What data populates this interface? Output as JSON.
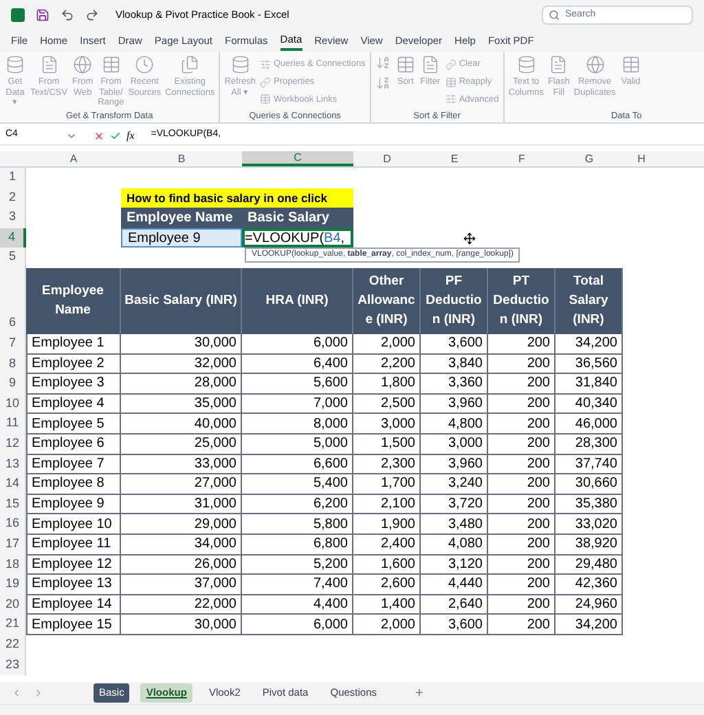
{
  "title_bar": {
    "title": "Vlookup & Pivot Practice Book  -  Excel",
    "search_placeholder": "Search"
  },
  "menu_tabs": [
    {
      "label": "File",
      "selected": false
    },
    {
      "label": "Home",
      "selected": false
    },
    {
      "label": "Insert",
      "selected": false
    },
    {
      "label": "Draw",
      "selected": false
    },
    {
      "label": "Page Layout",
      "selected": false
    },
    {
      "label": "Formulas",
      "selected": false
    },
    {
      "label": "Data",
      "selected": true
    },
    {
      "label": "Review",
      "selected": false
    },
    {
      "label": "View",
      "selected": false
    },
    {
      "label": "Developer",
      "selected": false
    },
    {
      "label": "Help",
      "selected": false
    },
    {
      "label": "Foxit PDF",
      "selected": false
    }
  ],
  "ribbon_groups": [
    {
      "label": "Get & Transform Data",
      "items": [
        {
          "kind": "large",
          "label": "Get Data ▾"
        },
        {
          "kind": "large",
          "label": "From Text/CSV"
        },
        {
          "kind": "large",
          "label": "From Web"
        },
        {
          "kind": "large",
          "label": "From Table/ Range"
        },
        {
          "kind": "large",
          "label": "Recent Sources"
        },
        {
          "kind": "large",
          "label": "Existing Connections"
        }
      ]
    },
    {
      "label": "Queries & Connections",
      "items": [
        {
          "kind": "large",
          "label": "Refresh All ▾"
        },
        {
          "kind": "small",
          "label": "Queries & Connections"
        },
        {
          "kind": "small",
          "label": "Properties"
        },
        {
          "kind": "small",
          "label": "Workbook Links"
        }
      ]
    },
    {
      "label": "Sort & Filter",
      "items": [
        {
          "kind": "sort",
          "label": "Sort"
        },
        {
          "kind": "large",
          "label": "Filter"
        },
        {
          "kind": "small",
          "label": "Clear"
        },
        {
          "kind": "small",
          "label": "Reapply"
        },
        {
          "kind": "small",
          "label": "Advanced"
        }
      ]
    },
    {
      "label": "Data To",
      "items": [
        {
          "kind": "large",
          "label": "Text to Columns"
        },
        {
          "kind": "large",
          "label": "Flash Fill"
        },
        {
          "kind": "large",
          "label": "Remove Duplicates"
        },
        {
          "kind": "large",
          "label": "Valid"
        }
      ]
    }
  ],
  "formula_bar": {
    "cell_ref": "C4",
    "function_label": "fx",
    "formula": "=VLOOKUP(B4,"
  },
  "columns": [
    {
      "label": "A",
      "selected": false
    },
    {
      "label": "B",
      "selected": false
    },
    {
      "label": "C",
      "selected": true
    },
    {
      "label": "D",
      "selected": false
    },
    {
      "label": "E",
      "selected": false
    },
    {
      "label": "F",
      "selected": false
    },
    {
      "label": "G",
      "selected": false
    },
    {
      "label": "H",
      "selected": false
    }
  ],
  "row_headers": [
    {
      "label": "1",
      "selected": false
    },
    {
      "label": "2",
      "selected": false
    },
    {
      "label": "3",
      "selected": false
    },
    {
      "label": "4",
      "selected": true
    },
    {
      "label": "5",
      "selected": false
    },
    {
      "label": "6",
      "selected": false
    },
    {
      "label": "7",
      "selected": false
    },
    {
      "label": "8",
      "selected": false
    },
    {
      "label": "9",
      "selected": false
    },
    {
      "label": "10",
      "selected": false
    },
    {
      "label": "11",
      "selected": false
    },
    {
      "label": "12",
      "selected": false
    },
    {
      "label": "13",
      "selected": false
    },
    {
      "label": "14",
      "selected": false
    },
    {
      "label": "15",
      "selected": false
    },
    {
      "label": "16",
      "selected": false
    },
    {
      "label": "17",
      "selected": false
    },
    {
      "label": "18",
      "selected": false
    },
    {
      "label": "19",
      "selected": false
    },
    {
      "label": "20",
      "selected": false
    },
    {
      "label": "21",
      "selected": false
    },
    {
      "label": "22",
      "selected": false
    },
    {
      "label": "23",
      "selected": false
    }
  ],
  "lookup": {
    "title": "How to find basic salary in one click",
    "headers": [
      "Employee Name",
      "Basic Salary"
    ],
    "employee": "Employee 9",
    "formula_start": "=VLOOKUP(",
    "formula_ref": "B4",
    "formula_end": ",",
    "tooltip": "VLOOKUP(lookup_value, **table_array**, col_index_num, [range_lookup])"
  },
  "table": {
    "columns": [
      "Employee Name",
      "Basic Salary (INR)",
      "HRA (INR)",
      "Other Allowance (INR)",
      "PF Deduction (INR)",
      "PT Deduction (INR)",
      "Total Salary (INR)"
    ],
    "rows": [
      [
        "Employee 1",
        "30,000",
        "6,000",
        "2,000",
        "3,600",
        "200",
        "34,200"
      ],
      [
        "Employee 2",
        "32,000",
        "6,400",
        "2,200",
        "3,840",
        "200",
        "36,560"
      ],
      [
        "Employee 3",
        "28,000",
        "5,600",
        "1,800",
        "3,360",
        "200",
        "31,840"
      ],
      [
        "Employee 4",
        "35,000",
        "7,000",
        "2,500",
        "3,960",
        "200",
        "40,340"
      ],
      [
        "Employee 5",
        "40,000",
        "8,000",
        "3,000",
        "4,800",
        "200",
        "46,000"
      ],
      [
        "Employee 6",
        "25,000",
        "5,000",
        "1,500",
        "3,000",
        "200",
        "28,300"
      ],
      [
        "Employee 7",
        "33,000",
        "6,600",
        "2,300",
        "3,960",
        "200",
        "37,740"
      ],
      [
        "Employee 8",
        "27,000",
        "5,400",
        "1,700",
        "3,240",
        "200",
        "30,660"
      ],
      [
        "Employee 9",
        "31,000",
        "6,200",
        "2,100",
        "3,720",
        "200",
        "35,380"
      ],
      [
        "Employee 10",
        "29,000",
        "5,800",
        "1,900",
        "3,480",
        "200",
        "33,020"
      ],
      [
        "Employee 11",
        "34,000",
        "6,800",
        "2,400",
        "4,080",
        "200",
        "38,920"
      ],
      [
        "Employee 12",
        "26,000",
        "5,200",
        "1,600",
        "3,120",
        "200",
        "29,480"
      ],
      [
        "Employee 13",
        "37,000",
        "7,400",
        "2,600",
        "4,440",
        "200",
        "42,360"
      ],
      [
        "Employee 14",
        "22,000",
        "4,400",
        "1,400",
        "2,640",
        "200",
        "24,960"
      ],
      [
        "Employee 15",
        "30,000",
        "6,000",
        "2,000",
        "3,600",
        "200",
        "34,200"
      ]
    ]
  },
  "sheet_tabs": [
    {
      "label": "Basic",
      "selected": false,
      "color": "#44546a"
    },
    {
      "label": "Vlookup",
      "selected": true
    },
    {
      "label": "Vlook2",
      "selected": false
    },
    {
      "label": "Pivot data",
      "selected": false
    },
    {
      "label": "Questions",
      "selected": false
    }
  ],
  "add_sheet": "+"
}
